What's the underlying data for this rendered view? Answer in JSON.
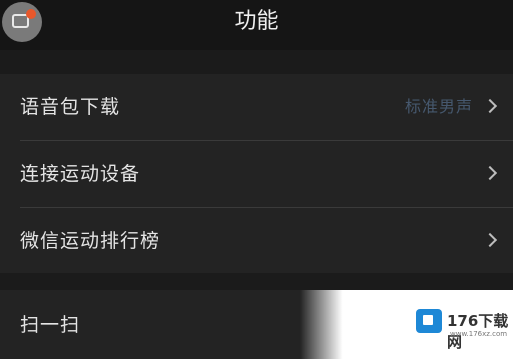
{
  "header": {
    "title": "功能",
    "back_icon": "back-notification-icon",
    "colors": {
      "background": "#151515",
      "badge": "#e8572a"
    }
  },
  "groups": [
    {
      "items": [
        {
          "label": "语音包下载",
          "value": "标准男声",
          "icon": "chevron-right-icon"
        },
        {
          "label": "连接运动设备",
          "icon": "chevron-right-icon"
        },
        {
          "label": "微信运动排行榜",
          "icon": "chevron-right-icon"
        }
      ]
    },
    {
      "items": [
        {
          "label": "扫一扫"
        }
      ]
    }
  ],
  "watermark": {
    "text": "176下载网",
    "sub": "www.176xz.com"
  }
}
